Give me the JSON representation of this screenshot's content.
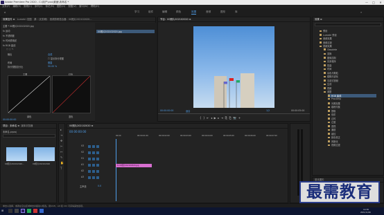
{
  "window": {
    "title": "Adobe Premiere Pro 2020 - C:\\用户\\xxx\\桌面\\未命名 *",
    "controls": [
      "—",
      "□",
      "✕"
    ]
  },
  "menu": [
    "文件(F)",
    "编辑(E)",
    "剪辑(C)",
    "序列(S)",
    "标记(M)",
    "图形(G)",
    "视图(V)",
    "窗口(W)",
    "帮助(H)"
  ],
  "workspaces": [
    "学习",
    "组件",
    "编辑",
    "颜色",
    "效果",
    "音频",
    "图形",
    "库"
  ],
  "active_workspace": "效果",
  "effect_controls": {
    "tabs": [
      "效果控件 ≡",
      "Lumetri 范围",
      "源：(无剪辑)",
      "音频剪辑混合器：00照片202102020..."
    ],
    "source_label": "主要 * 00照片202102020.jpg",
    "clip_label": "00照片202102020.jpg",
    "rows": [
      "fx 运动",
      "fx 不透明度",
      "fx 时间重映射",
      "fx RGB 曲线"
    ],
    "output_label": "输出",
    "output_value": "合成",
    "show_split": "显示拆分视图",
    "layout_label": "布局",
    "layout_value": "垂直",
    "split_label": "拆分视图百分比",
    "split_value": "50.00 %",
    "curve_labels": [
      "主要",
      "红色"
    ],
    "channel_labels": [
      "绿色",
      "蓝色"
    ],
    "timecode": "00:00:00:00"
  },
  "program": {
    "title": "节目：00照片202102020 ≡",
    "timecode_left": "00:00:00:00",
    "fit": "适合",
    "quality": "1/2",
    "timecode_right": "00:00:05:00"
  },
  "project": {
    "tabs": [
      "项目：未命名 ≡",
      "媒体浏览器"
    ],
    "path": "未命名.prproj",
    "items": [
      {
        "name": "00照片202102020...",
        "duration": "5:00"
      },
      {
        "name": "00照片202102020",
        "duration": "5:00"
      }
    ]
  },
  "timeline": {
    "title": "00照片202102020 ≡",
    "timecode": "00:00:00:00",
    "ruler": [
      "00:00",
      "00:00:01:00",
      "00:00:02:00",
      "00:00:03:00",
      "00:00:04:00",
      "00:00:05:00",
      "00:00:06:00",
      "00:00:07:00"
    ],
    "tracks": [
      "V3",
      "V2",
      "V1",
      "A1",
      "A2",
      "A3"
    ],
    "master": "主声道",
    "master_value": "0.0",
    "clip": "fx 00照片202102020.jpg"
  },
  "effects": {
    "title": "效果 ≡",
    "folders": [
      "预设",
      "Lumetri 预设",
      "音频效果",
      "音频过渡",
      "视频效果",
      "Obsolete",
      "变换",
      "图像控制",
      "实用程序",
      "扭曲",
      "时间",
      "杂色与颗粒",
      "模糊与锐化",
      "沉浸式视频",
      "生成",
      "视频",
      "调整",
      "RGB 曲线",
      "ProcAmp",
      "光照效果",
      "卷积内核",
      "提取",
      "色阶",
      "过时",
      "过渡",
      "透视",
      "通道",
      "键控",
      "颜色校正",
      "风格化",
      "视频过渡"
    ],
    "highlight": "RGB 曲线"
  },
  "essential": "基本图形",
  "status": "单击以选择，或者在空白区域单击并拖动以框选。用Shift、Alt 和 Ctrl 可获得其他选项。",
  "watermark": "最需教育",
  "clock": {
    "time": "14:36",
    "date": "2021/11/26"
  }
}
